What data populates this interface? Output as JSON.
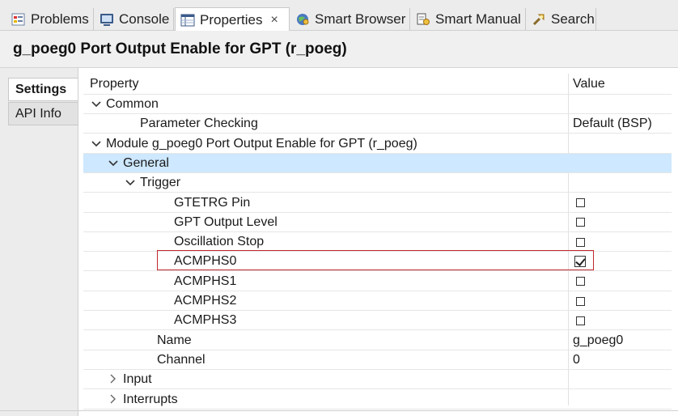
{
  "tabs": [
    {
      "label": "Problems",
      "icon": "problems-icon"
    },
    {
      "label": "Console",
      "icon": "console-icon"
    },
    {
      "label": "Properties",
      "icon": "properties-icon",
      "active": true,
      "close": "×"
    },
    {
      "label": "Smart Browser",
      "icon": "smart-browser-icon"
    },
    {
      "label": "Smart Manual",
      "icon": "smart-manual-icon"
    },
    {
      "label": "Search",
      "icon": "search-icon"
    }
  ],
  "title": "g_poeg0 Port Output Enable for GPT (r_poeg)",
  "side_tabs": [
    {
      "label": "Settings",
      "active": true
    },
    {
      "label": "API Info",
      "active": false
    }
  ],
  "table": {
    "header": {
      "property": "Property",
      "value": "Value"
    },
    "rows": [
      {
        "label": "Common",
        "indent": 0,
        "chevron": "down",
        "value": ""
      },
      {
        "label": "Parameter Checking",
        "indent": 2,
        "chevron": "",
        "value": "Default (BSP)"
      },
      {
        "label": "Module g_poeg0 Port Output Enable for GPT (r_poeg)",
        "indent": 0,
        "chevron": "down",
        "value": ""
      },
      {
        "label": "General",
        "indent": 1,
        "chevron": "down",
        "value": "",
        "selected": true
      },
      {
        "label": "Trigger",
        "indent": 2,
        "chevron": "down",
        "value": ""
      },
      {
        "label": "GTETRG Pin",
        "indent": 4,
        "chevron": "",
        "checkbox": false
      },
      {
        "label": "GPT Output Level",
        "indent": 4,
        "chevron": "",
        "checkbox": false
      },
      {
        "label": "Oscillation Stop",
        "indent": 4,
        "chevron": "",
        "checkbox": false
      },
      {
        "label": "ACMPHS0",
        "indent": 4,
        "chevron": "",
        "checkbox": true
      },
      {
        "label": "ACMPHS1",
        "indent": 4,
        "chevron": "",
        "checkbox": false
      },
      {
        "label": "ACMPHS2",
        "indent": 4,
        "chevron": "",
        "checkbox": false
      },
      {
        "label": "ACMPHS3",
        "indent": 4,
        "chevron": "",
        "checkbox": false
      },
      {
        "label": "Name",
        "indent": 3,
        "chevron": "",
        "value": "g_poeg0"
      },
      {
        "label": "Channel",
        "indent": 3,
        "chevron": "",
        "value": "0"
      },
      {
        "label": "Input",
        "indent": 1,
        "chevron": "right",
        "value": ""
      },
      {
        "label": "Interrupts",
        "indent": 1,
        "chevron": "right",
        "value": ""
      }
    ]
  },
  "colors": {
    "selected_row": "#cde8ff",
    "highlight_border": "#c0282d"
  }
}
